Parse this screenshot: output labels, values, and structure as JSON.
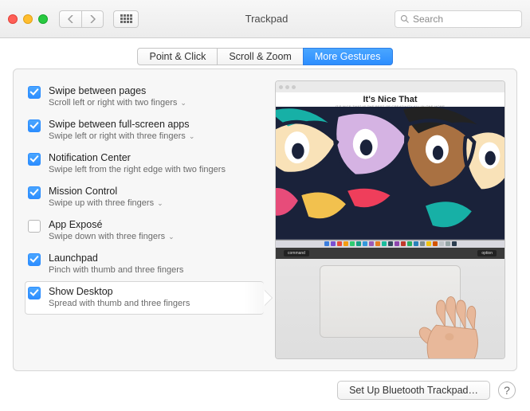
{
  "window_title": "Trackpad",
  "search_placeholder": "Search",
  "tabs": [
    {
      "label": "Point & Click",
      "selected": false
    },
    {
      "label": "Scroll & Zoom",
      "selected": false
    },
    {
      "label": "More Gestures",
      "selected": true
    }
  ],
  "options": [
    {
      "title": "Swipe between pages",
      "desc": "Scroll left or right with two fingers",
      "checked": true,
      "dropdown": true,
      "selected": false
    },
    {
      "title": "Swipe between full-screen apps",
      "desc": "Swipe left or right with three fingers",
      "checked": true,
      "dropdown": true,
      "selected": false
    },
    {
      "title": "Notification Center",
      "desc": "Swipe left from the right edge with two fingers",
      "checked": true,
      "dropdown": false,
      "selected": false
    },
    {
      "title": "Mission Control",
      "desc": "Swipe up with three fingers",
      "checked": true,
      "dropdown": true,
      "selected": false
    },
    {
      "title": "App Exposé",
      "desc": "Swipe down with three fingers",
      "checked": false,
      "dropdown": true,
      "selected": false
    },
    {
      "title": "Launchpad",
      "desc": "Pinch with thumb and three fingers",
      "checked": true,
      "dropdown": false,
      "selected": false
    },
    {
      "title": "Show Desktop",
      "desc": "Spread with thumb and three fingers",
      "checked": true,
      "dropdown": false,
      "selected": true
    }
  ],
  "preview": {
    "site_title": "It's Nice That",
    "site_tagline": "IT'S NICE THAT  IS THE BEST OF CREATIVITY  ALL IN ONE HOME",
    "key_left": "command",
    "key_right": "option"
  },
  "footer_button": "Set Up Bluetooth Trackpad…",
  "colors": {
    "accent": "#2d8eff"
  },
  "dock_colors": [
    "#3b7ddd",
    "#7a4fd2",
    "#e74c3c",
    "#f39c12",
    "#2ecc71",
    "#16a085",
    "#3498db",
    "#9b59b6",
    "#e67e22",
    "#1abc9c",
    "#34495e",
    "#8e44ad",
    "#c0392b",
    "#27ae60",
    "#2980b9",
    "#7f8c8d",
    "#f1c40f",
    "#d35400",
    "#bdc3c7",
    "#95a5a6",
    "#2c3e50"
  ]
}
